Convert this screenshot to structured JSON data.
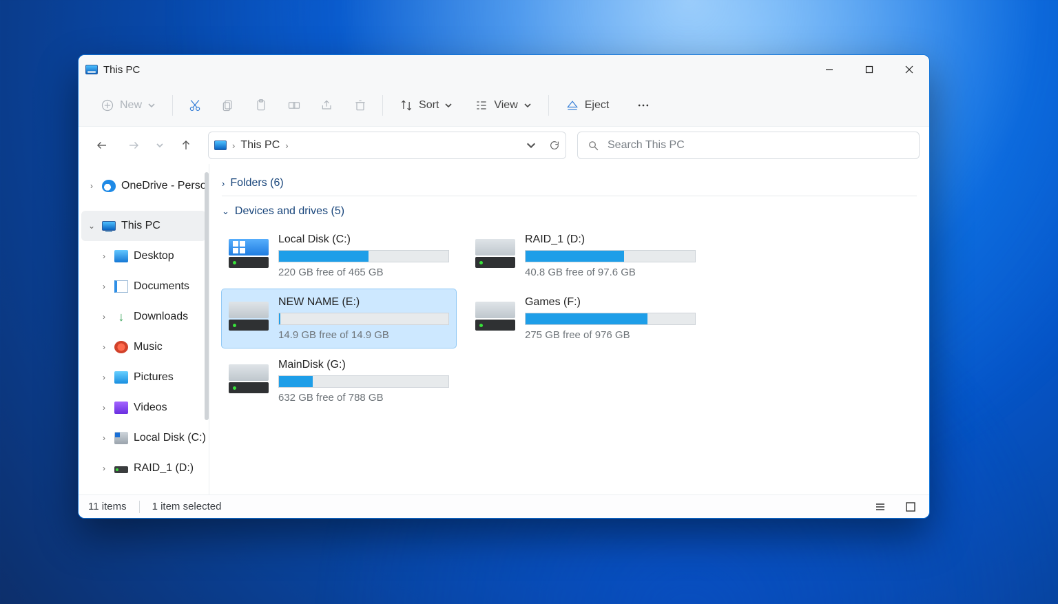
{
  "window": {
    "title": "This PC"
  },
  "toolbar": {
    "new": "New",
    "sort": "Sort",
    "view": "View",
    "eject": "Eject"
  },
  "breadcrumb": {
    "root": "This PC"
  },
  "search": {
    "placeholder": "Search This PC"
  },
  "sidebar": {
    "onedrive": "OneDrive - Perso",
    "this_pc": "This PC",
    "items": [
      {
        "label": "Desktop"
      },
      {
        "label": "Documents"
      },
      {
        "label": "Downloads"
      },
      {
        "label": "Music"
      },
      {
        "label": "Pictures"
      },
      {
        "label": "Videos"
      },
      {
        "label": "Local Disk (C:)"
      },
      {
        "label": "RAID_1 (D:)"
      }
    ]
  },
  "sections": {
    "folders": "Folders (6)",
    "drives": "Devices and drives (5)"
  },
  "drives": [
    {
      "name": "Local Disk (C:)",
      "free": "220 GB free of 465 GB",
      "fill_pct": 53,
      "system": true,
      "selected": false
    },
    {
      "name": "RAID_1 (D:)",
      "free": "40.8 GB free of 97.6 GB",
      "fill_pct": 58,
      "system": false,
      "selected": false
    },
    {
      "name": "NEW NAME (E:)",
      "free": "14.9 GB free of 14.9 GB",
      "fill_pct": 1,
      "system": false,
      "selected": true
    },
    {
      "name": "Games (F:)",
      "free": "275 GB free of 976 GB",
      "fill_pct": 72,
      "system": false,
      "selected": false
    },
    {
      "name": "MainDisk (G:)",
      "free": "632 GB free of 788 GB",
      "fill_pct": 20,
      "system": false,
      "selected": false
    }
  ],
  "status": {
    "count": "11 items",
    "selection": "1 item selected"
  }
}
